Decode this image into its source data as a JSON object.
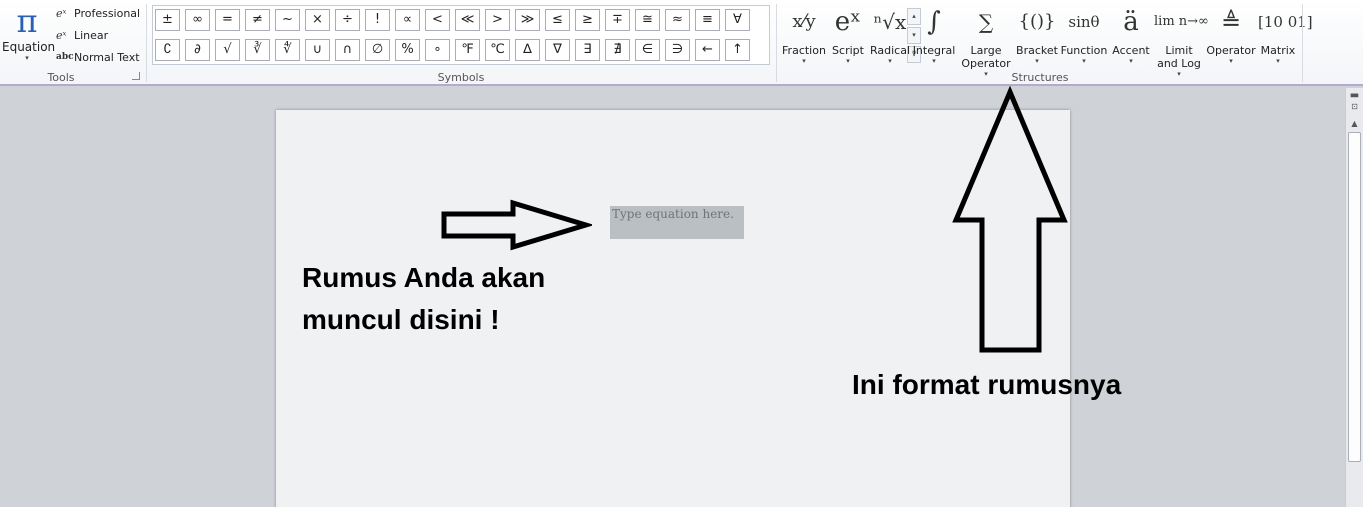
{
  "ribbon": {
    "tools": {
      "group_label": "Tools",
      "equation_symbol": "π",
      "equation_label": "Equation",
      "dropdown_glyph": "▾",
      "items": [
        {
          "icon": "eˣ",
          "label": "Professional"
        },
        {
          "icon": "eˣ",
          "label": "Linear"
        },
        {
          "icon": "abc",
          "label": "Normal Text"
        }
      ]
    },
    "symbols": {
      "group_label": "Symbols",
      "row1": [
        "±",
        "∞",
        "=",
        "≠",
        "~",
        "×",
        "÷",
        "!",
        "∝",
        "<",
        "≪",
        ">",
        "≫",
        "≤",
        "≥",
        "∓",
        "≅",
        "≈",
        "≡",
        "∀"
      ],
      "row2": [
        "∁",
        "∂",
        "√",
        "∛",
        "∜",
        "∪",
        "∩",
        "∅",
        "%",
        "∘",
        "℉",
        "℃",
        "∆",
        "∇",
        "∃",
        "∄",
        "∈",
        "∋",
        "←",
        "↑"
      ],
      "scroll_up": "▴",
      "scroll_down": "▾",
      "more": "⊽"
    },
    "structures": {
      "group_label": "Structures",
      "items": [
        {
          "icon": "x⁄y",
          "label": "Fraction"
        },
        {
          "icon": "eˣ",
          "label": "Script"
        },
        {
          "icon": "ⁿ√x",
          "label": "Radical"
        },
        {
          "icon": "∫",
          "label": "Integral"
        },
        {
          "icon": "∑",
          "label": "Large Operator"
        },
        {
          "icon": "{()}",
          "label": "Bracket"
        },
        {
          "icon": "sinθ",
          "label": "Function"
        },
        {
          "icon": "ä",
          "label": "Accent"
        },
        {
          "icon": "lim n→∞",
          "label": "Limit and Log"
        },
        {
          "icon": "≜",
          "label": "Operator"
        },
        {
          "icon": "[10 01]",
          "label": "Matrix"
        }
      ]
    }
  },
  "document": {
    "placeholder": "Type equation here.",
    "annotation_left": "Rumus Anda akan muncul disini !",
    "annotation_right": "Ini format rumusnya"
  }
}
